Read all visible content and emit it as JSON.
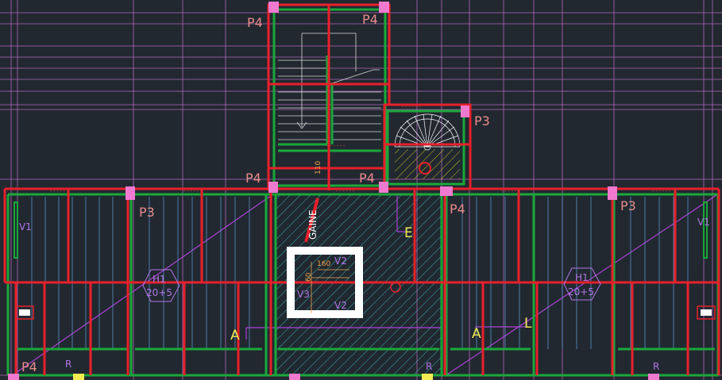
{
  "colors": {
    "background": "#212830",
    "grid": "#d070d0",
    "beam": "#e8202a",
    "wall": "#1aa83a",
    "pillar": "#f07ad0",
    "hatch": "#3ab0b0",
    "label": "#ea8a8a",
    "yellow": "#f2ec52",
    "purple": "#b276e6"
  },
  "labels": {
    "p4_top_left": "P4",
    "p4_top_right": "P4",
    "p3_right": "P3",
    "p4_mid_left": "P4",
    "p4_mid_right": "P4",
    "p3_left": "P3",
    "p4_lower_right": "P4",
    "p3_far_right": "P3",
    "p4_bottom_left": "P4",
    "v1_left": "V1",
    "v1_right": "V1",
    "h1_left": "H1",
    "h1_left_value": "20+5",
    "h1_right": "H1",
    "h1_right_value": "20+5",
    "a_left": "A",
    "a_right": "A",
    "e_label": "E",
    "l_label": "L",
    "r_left": "R",
    "r_mid": "R",
    "r_right": "R",
    "gaine": "GAINE",
    "v2_top": "V2",
    "v2_bottom": "V2",
    "v3": "V3",
    "dim_160": "160",
    "dim_60": "60",
    "dim_110": "110"
  }
}
